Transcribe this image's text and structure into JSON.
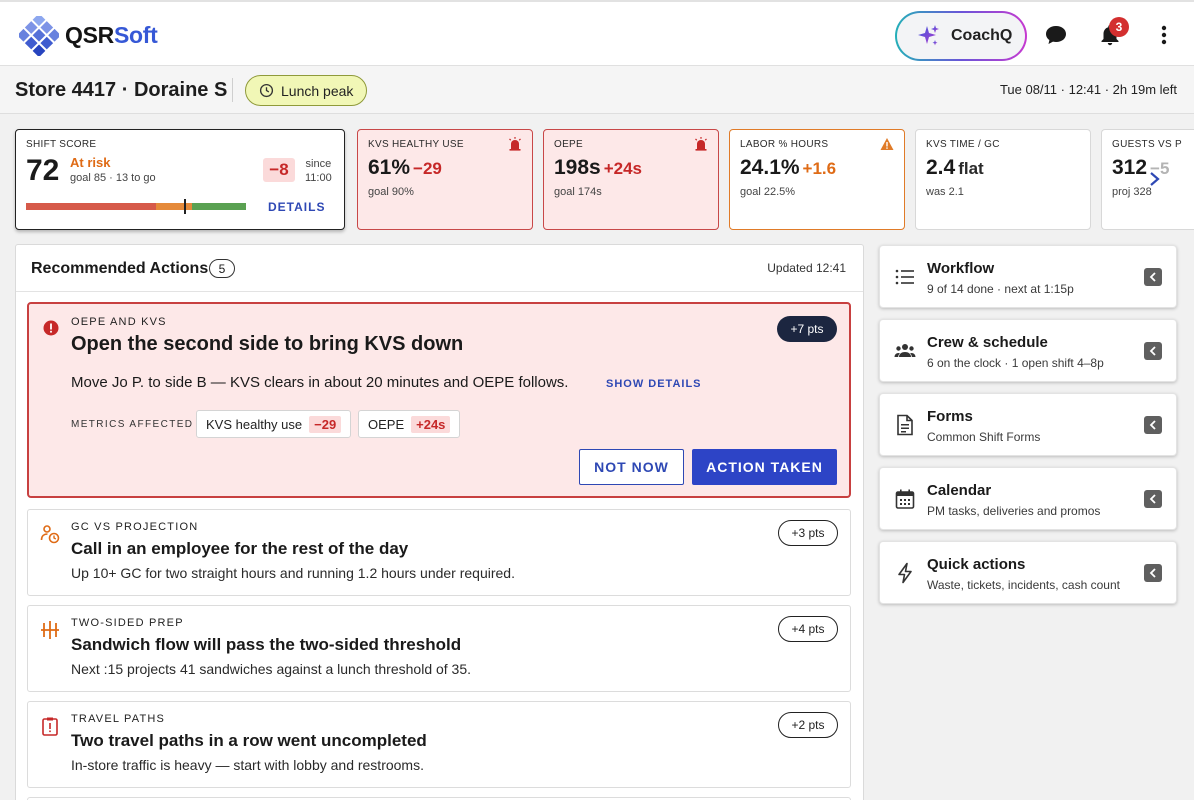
{
  "header": {
    "brand_part1": "QSR",
    "brand_part2": "Soft",
    "coach_label": "CoachQ",
    "notification_count": "3",
    "icons": [
      "chat-icon",
      "bell-icon",
      "more-vert-icon"
    ]
  },
  "store": {
    "title": "Store 4417 · Doraine S",
    "peak_label": "Lunch peak",
    "datetime": "Tue 08/11 · 12:41 · 2h 19m left"
  },
  "shift_score": {
    "label": "SHIFT SCORE",
    "value": "72",
    "status": "At risk",
    "goal": "goal 85 · 13 to go",
    "delta": "−8",
    "since_line1": "since",
    "since_line2": "11:00",
    "details_label": "DETAILS"
  },
  "kpis": [
    {
      "label": "KVS HEALTHY USE",
      "value": "61%",
      "delta": "−29",
      "goal": "goal 90%"
    },
    {
      "label": "OEPE",
      "value": "198s",
      "delta": "+24s",
      "goal": "goal 174s"
    },
    {
      "label": "LABOR % HOURS",
      "value": "24.1%",
      "delta": "+1.6",
      "goal": "goal 22.5%"
    },
    {
      "label": "KVS TIME / GC",
      "value": "2.4",
      "delta": "flat",
      "goal": "was 2.1"
    },
    {
      "label": "GUESTS VS P",
      "value": "312",
      "delta": "−5",
      "goal": "proj 328"
    }
  ],
  "recommended": {
    "title": "Recommended Actions",
    "count": "5",
    "updated": "Updated 12:41",
    "primary": {
      "category": "OEPE AND KVS",
      "title": "Open the second side to bring KVS down",
      "points": "+7 pts",
      "description": "Move Jo P. to side B — KVS clears in about 20 minutes and OEPE follows.",
      "show_details": "SHOW DETAILS",
      "metrics_label": "METRICS AFFECTED",
      "metrics": [
        {
          "name": "KVS healthy use",
          "delta": "−29"
        },
        {
          "name": "OEPE",
          "delta": "+24s"
        }
      ],
      "not_now": "NOT NOW",
      "action_taken": "ACTION TAKEN"
    },
    "items": [
      {
        "category": "GC VS PROJECTION",
        "title": "Call in an employee for the rest of the day",
        "description": "Up 10+ GC for two straight hours and running 1.2 hours under required.",
        "points": "+3 pts"
      },
      {
        "category": "TWO-SIDED PREP",
        "title": "Sandwich flow will pass the two-sided threshold",
        "description": "Next :15 projects 41 sandwiches against a lunch threshold of 35.",
        "points": "+4 pts"
      },
      {
        "category": "TRAVEL PATHS",
        "title": "Two travel paths in a row went uncompleted",
        "description": "In-store traffic is heavy — start with lobby and restrooms.",
        "points": "+2 pts"
      }
    ]
  },
  "side_cards": [
    {
      "title": "Workflow",
      "subtitle": "9 of 14 done · next at 1:15p"
    },
    {
      "title": "Crew & schedule",
      "subtitle": "6 on the clock · 1 open shift 4–8p"
    },
    {
      "title": "Forms",
      "subtitle": "Common Shift Forms"
    },
    {
      "title": "Calendar",
      "subtitle": "PM tasks, deliveries and promos"
    },
    {
      "title": "Quick actions",
      "subtitle": "Waste, tickets, incidents, cash count"
    }
  ],
  "colors": {
    "accent": "#2d44c6",
    "danger": "#c62828",
    "warning": "#df6b16",
    "danger_bg": "#fde8e8"
  },
  "score_bar": {
    "segments": [
      {
        "fraction": 0.59,
        "color": "#d65a4a"
      },
      {
        "fraction": 0.165,
        "color": "#e58a3a"
      },
      {
        "fraction": 0.245,
        "color": "#5aa152"
      }
    ],
    "marker_fraction": 0.72
  }
}
